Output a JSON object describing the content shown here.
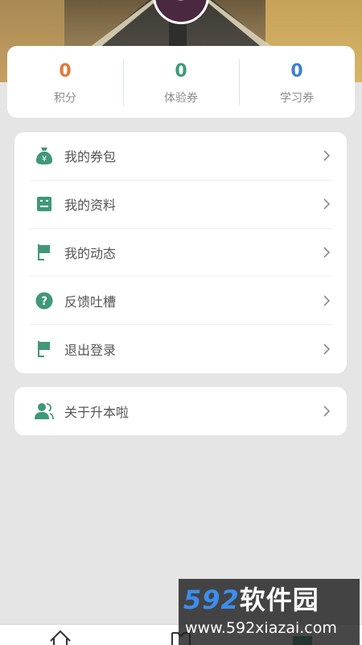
{
  "avatar": {
    "initial": "S"
  },
  "stats": [
    {
      "value": "0",
      "label": "积分",
      "color": "#e07a3a"
    },
    {
      "value": "0",
      "label": "体验券",
      "color": "#3f9878"
    },
    {
      "value": "0",
      "label": "学习券",
      "color": "#3d7fd0"
    }
  ],
  "menu": {
    "items": [
      {
        "label": "我的券包",
        "icon": "money-bag-icon"
      },
      {
        "label": "我的资料",
        "icon": "profile-card-icon"
      },
      {
        "label": "我的动态",
        "icon": "flag-icon"
      },
      {
        "label": "反馈吐槽",
        "icon": "question-icon"
      },
      {
        "label": "退出登录",
        "icon": "flag-icon"
      }
    ]
  },
  "menu2": {
    "items": [
      {
        "label": "关于升本啦",
        "icon": "users-icon"
      }
    ]
  },
  "colors": {
    "accent": "#3f9878",
    "background": "#e5e5e5"
  },
  "tabbar": {
    "icons": [
      "home-icon",
      "book-icon",
      "chart-icon"
    ]
  },
  "watermark": {
    "number": "592",
    "text": "软件园",
    "url": "www.592xiazai.com"
  }
}
